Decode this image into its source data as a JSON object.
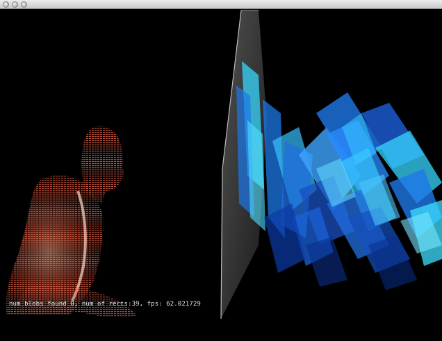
{
  "window": {
    "title": ""
  },
  "controls": {
    "close": "close-icon",
    "minimize": "minimize-icon",
    "zoom": "zoom-icon"
  },
  "overlay": {
    "stats_text": "num blobs found 0, num of rects:39, fps: 62.021729"
  },
  "colors": {
    "background": "#000000",
    "point_cloud": "#d9553c",
    "rect_light": "#38d5ff",
    "rect_mid": "#1e78e8",
    "rect_deep": "#0b3aa8",
    "panel_edge": "#8f8f8f"
  }
}
